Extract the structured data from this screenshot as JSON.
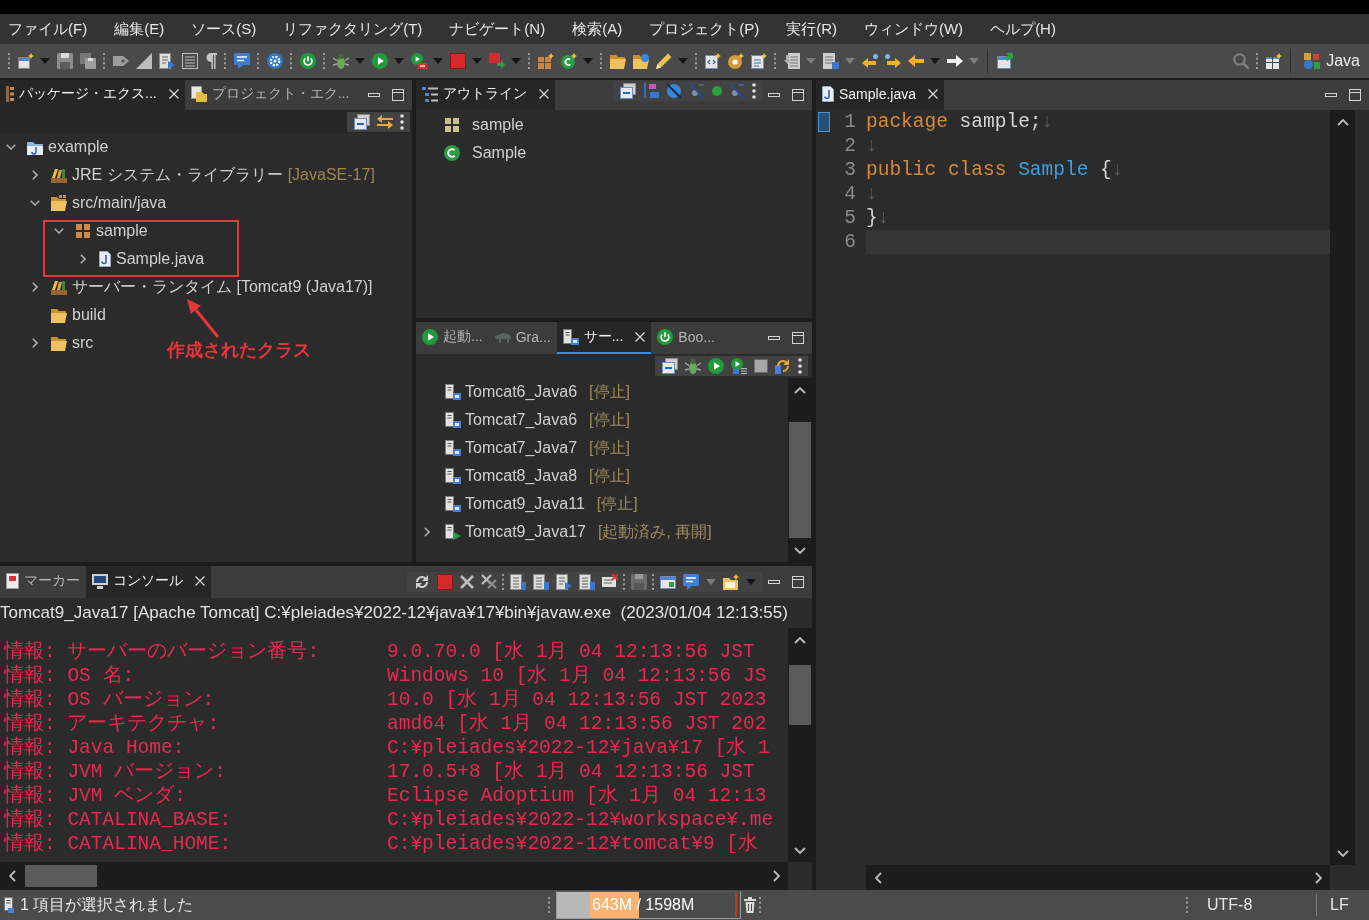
{
  "menu_bar": {
    "items": [
      "ファイル(F)",
      "編集(E)",
      "ソース(S)",
      "リファクタリング(T)",
      "ナビゲート(N)",
      "検索(A)",
      "プロジェクト(P)",
      "実行(R)",
      "ウィンドウ(W)",
      "ヘルプ(H)"
    ]
  },
  "toolbar": {
    "perspective": "Java"
  },
  "package_explorer": {
    "active": false,
    "tabs": [
      {
        "label": "パッケージ・エクス...",
        "selected": true
      },
      {
        "label": "プロジェクト・エク...",
        "selected": false
      }
    ],
    "tree": [
      {
        "label": "example",
        "kind": "project",
        "expanded": true,
        "children": [
          {
            "label": "JRE システム・ライブラリー",
            "decoration": "[JavaSE-17]",
            "kind": "library",
            "expanded": false
          },
          {
            "label": "src/main/java",
            "kind": "source-folder",
            "expanded": true,
            "children": [
              {
                "label": "sample",
                "kind": "package",
                "expanded": true,
                "children": [
                  {
                    "label": "Sample.java",
                    "kind": "java-file",
                    "expanded": false
                  }
                ]
              }
            ]
          },
          {
            "label": "サーバー・ランタイム [Tomcat9 (Java17)]",
            "kind": "library",
            "expanded": false
          },
          {
            "label": "build",
            "kind": "folder"
          },
          {
            "label": "src",
            "kind": "folder",
            "expanded": false
          }
        ]
      }
    ],
    "annotation": {
      "label": "作成されたクラス"
    }
  },
  "outline": {
    "active": false,
    "tabs": [
      {
        "label": "アウトライン",
        "selected": true
      }
    ],
    "items": [
      {
        "label": "sample",
        "kind": "package"
      },
      {
        "label": "Sample",
        "kind": "class"
      }
    ]
  },
  "servers_view": {
    "active": true,
    "tabs": [
      {
        "label": "起動...",
        "selected": false
      },
      {
        "label": "Gra...",
        "selected": false
      },
      {
        "label": "サー...",
        "selected": true
      },
      {
        "label": "Boo...",
        "selected": false
      }
    ],
    "servers": [
      {
        "name": "Tomcat6_Java6",
        "status": "[停止]",
        "running": false
      },
      {
        "name": "Tomcat7_Java6",
        "status": "[停止]",
        "running": false
      },
      {
        "name": "Tomcat7_Java7",
        "status": "[停止]",
        "running": false
      },
      {
        "name": "Tomcat8_Java8",
        "status": "[停止]",
        "running": false
      },
      {
        "name": "Tomcat9_Java11",
        "status": "[停止]",
        "running": false
      },
      {
        "name": "Tomcat9_Java17",
        "status": "[起動済み, 再開]",
        "running": true,
        "expanded": false
      }
    ]
  },
  "editor": {
    "active": false,
    "tabs": [
      {
        "label": "Sample.java",
        "selected": true
      }
    ],
    "lines": [
      {
        "number": "1",
        "current": false,
        "tokens": [
          {
            "text": "package",
            "kind": "keyword"
          },
          {
            "text": " sample;",
            "kind": "plain"
          },
          {
            "text": "↓",
            "kind": "whitespace"
          }
        ]
      },
      {
        "number": "2",
        "current": false,
        "tokens": [
          {
            "text": "↓",
            "kind": "whitespace"
          }
        ]
      },
      {
        "number": "3",
        "current": false,
        "tokens": [
          {
            "text": "public class",
            "kind": "keyword"
          },
          {
            "text": " Sample",
            "kind": "type"
          },
          {
            "text": " {",
            "kind": "plain"
          },
          {
            "text": "↓",
            "kind": "whitespace"
          }
        ]
      },
      {
        "number": "4",
        "current": false,
        "tokens": [
          {
            "text": "↓",
            "kind": "whitespace"
          }
        ]
      },
      {
        "number": "5",
        "current": false,
        "tokens": [
          {
            "text": "}",
            "kind": "plain"
          },
          {
            "text": "↓",
            "kind": "whitespace"
          }
        ]
      },
      {
        "number": "6",
        "current": true
      }
    ]
  },
  "console": {
    "active": false,
    "tabs": [
      {
        "label": "マーカー",
        "selected": false
      },
      {
        "label": "コンソール",
        "selected": true
      }
    ],
    "description": "Tomcat9_Java17 [Apache Tomcat] C:¥pleiades¥2022-12¥java¥17¥bin¥javaw.exe  (2023/01/04 12:13:55)",
    "lines": [
      {
        "label": "情報: サーバーのバージョン番号:",
        "value": "9.0.70.0 [水 1月 04 12:13:56 JST"
      },
      {
        "label": "情報: OS 名:",
        "value": "Windows 10 [水 1月 04 12:13:56 JS"
      },
      {
        "label": "情報: OS バージョン:",
        "value": "10.0 [水 1月 04 12:13:56 JST 2023"
      },
      {
        "label": "情報: アーキテクチャ:",
        "value": "amd64 [水 1月 04 12:13:56 JST 202"
      },
      {
        "label": "情報: Java Home:",
        "value": "C:¥pleiades¥2022-12¥java¥17 [水 1"
      },
      {
        "label": "情報: JVM バージョン:",
        "value": "17.0.5+8 [水 1月 04 12:13:56 JST"
      },
      {
        "label": "情報: JVM ベンダ:",
        "value": "Eclipse Adoptium [水 1月 04 12:13"
      },
      {
        "label": "情報: CATALINA_BASE:",
        "value": "C:¥pleiades¥2022-12¥workspace¥.me"
      },
      {
        "label": "情報: CATALINA_HOME:",
        "value": "C:¥pleiades¥2022-12¥tomcat¥9 [水"
      }
    ]
  },
  "status_bar": {
    "message": "1 項目が選択されました",
    "heap": {
      "reading": "643M / 1598M",
      "level": 0.45
    },
    "encoding": "UTF-8",
    "line_delimiter": "LF"
  }
}
